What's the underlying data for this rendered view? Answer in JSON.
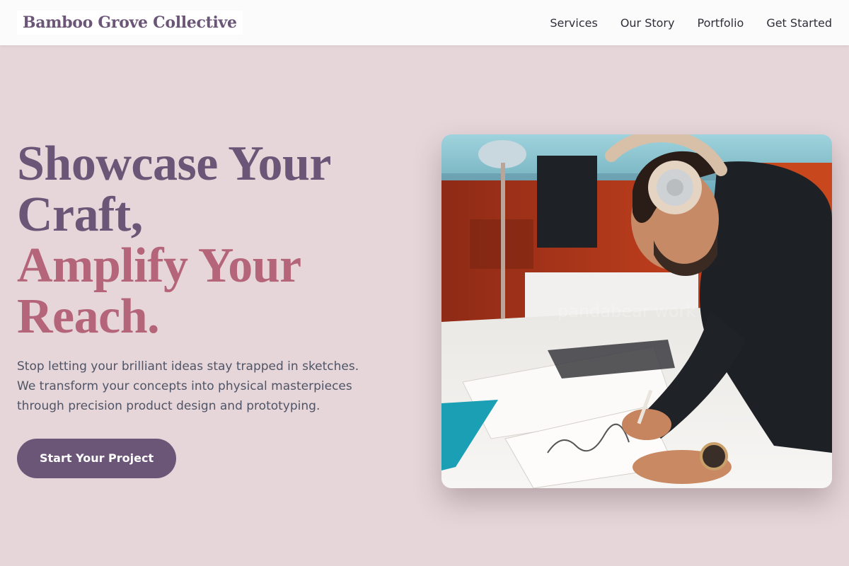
{
  "header": {
    "brand": "Bamboo Grove Collective",
    "nav": [
      "Services",
      "Our Story",
      "Portfolio",
      "Get Started"
    ]
  },
  "hero": {
    "headline_line1": "Showcase Your",
    "headline_line2": "Craft,",
    "headline_accent_line1": "Amplify Your",
    "headline_accent_line2": "Reach.",
    "subtext_line1": "Stop letting your brilliant ideas stay trapped in sketches.",
    "subtext_line2": "We transform your concepts into physical masterpieces",
    "subtext_line3": "through precision product design and prototyping.",
    "cta_label": "Start Your Project",
    "image": {
      "icon": "designer-sketching-photo",
      "watermark": "pandabear work"
    }
  },
  "colors": {
    "background": "#e6d6d9",
    "primary": "#6c5677",
    "accent": "#b56579",
    "navbar": "#fcfbfc",
    "body_text": "#4f5566"
  }
}
